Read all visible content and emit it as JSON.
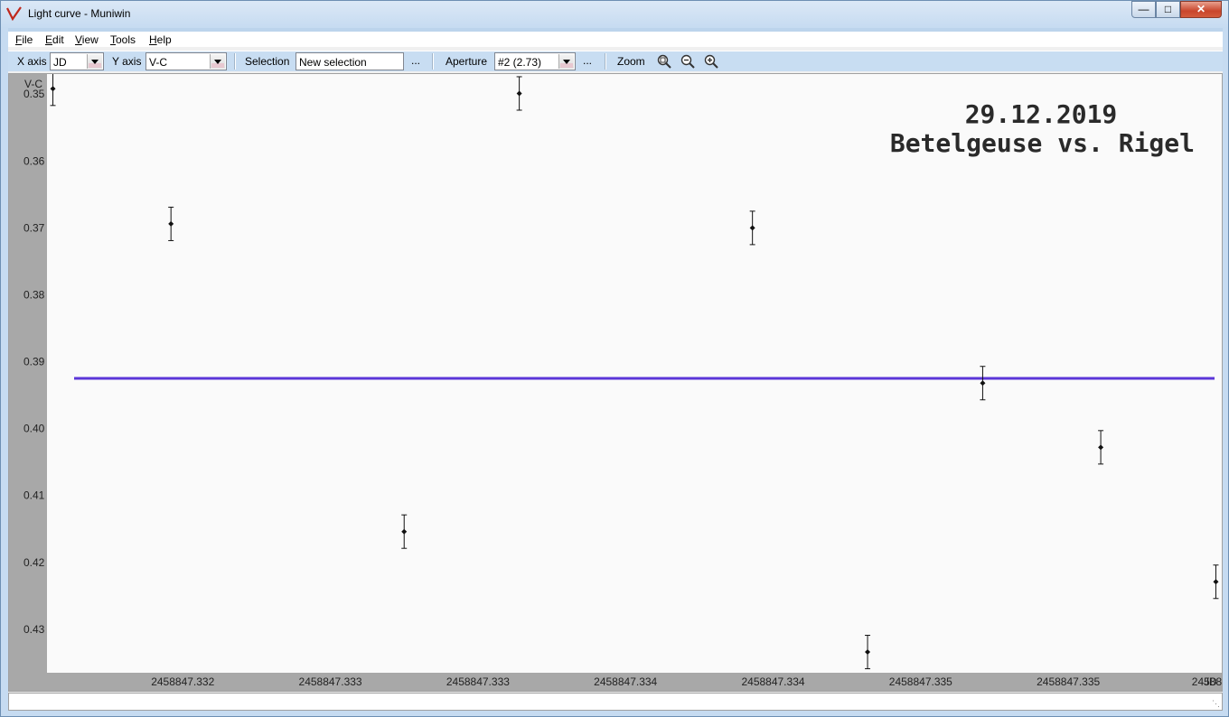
{
  "window": {
    "title": "Light curve - Muniwin"
  },
  "menu": [
    {
      "label": "File",
      "key": "F",
      "rest": "ile"
    },
    {
      "label": "Edit",
      "key": "E",
      "rest": "dit"
    },
    {
      "label": "View",
      "key": "V",
      "rest": "iew"
    },
    {
      "label": "Tools",
      "key": "T",
      "rest": "ools"
    },
    {
      "label": "Help",
      "key": "H",
      "rest": "elp"
    }
  ],
  "toolbar": {
    "x_axis_label": "X axis",
    "x_axis_value": "JD",
    "y_axis_label": "Y axis",
    "y_axis_value": "V-C",
    "selection_label": "Selection",
    "selection_value": "New selection",
    "selection_more": "...",
    "aperture_label": "Aperture",
    "aperture_value": "#2 (2.73)",
    "aperture_more": "...",
    "zoom_label": "Zoom",
    "zoom_icons": [
      "zoom-fit-icon",
      "zoom-out-icon",
      "zoom-in-icon"
    ]
  },
  "chart_data": {
    "type": "scatter",
    "ylabel": "V-C",
    "xlabel": "JD",
    "y_inverted": true,
    "ylim": [
      0.347,
      0.4365
    ],
    "xlim": [
      2458847.33174,
      2458847.33572
    ],
    "y_ticks": [
      0.35,
      0.36,
      0.37,
      0.38,
      0.39,
      0.4,
      0.41,
      0.42,
      0.43
    ],
    "y_tick_labels": [
      "0.35",
      "0.36",
      "0.37",
      "0.38",
      "0.39",
      "0.40",
      "0.41",
      "0.42",
      "0.43"
    ],
    "x_ticks": [
      2458847.3322,
      2458847.3327,
      2458847.3332,
      2458847.3337,
      2458847.3342,
      2458847.3347,
      2458847.3352,
      2458847.3357
    ],
    "x_tick_labels": [
      "2458847.332",
      "2458847.333",
      "2458847.333",
      "2458847.334",
      "2458847.334",
      "2458847.335",
      "2458847.335",
      "2458847.:"
    ],
    "points": [
      {
        "x": 2458847.33176,
        "y": 0.3492,
        "err": 0.0025
      },
      {
        "x": 2458847.33216,
        "y": 0.3694,
        "err": 0.0025
      },
      {
        "x": 2458847.33295,
        "y": 0.4154,
        "err": 0.0025
      },
      {
        "x": 2458847.33334,
        "y": 0.3499,
        "err": 0.0025
      },
      {
        "x": 2458847.33413,
        "y": 0.37,
        "err": 0.0025
      },
      {
        "x": 2458847.33452,
        "y": 0.4334,
        "err": 0.0025
      },
      {
        "x": 2458847.33491,
        "y": 0.3932,
        "err": 0.0025
      },
      {
        "x": 2458847.33531,
        "y": 0.4028,
        "err": 0.0025
      },
      {
        "x": 2458847.3357,
        "y": 0.4229,
        "err": 0.0025
      }
    ],
    "mean_line": {
      "y": 0.3925,
      "color": "#5b36d8"
    },
    "annotation": [
      "29.12.2019",
      "Betelgeuse vs. Rigel"
    ],
    "grid": false,
    "axis_bg": "#a8a8a8"
  }
}
